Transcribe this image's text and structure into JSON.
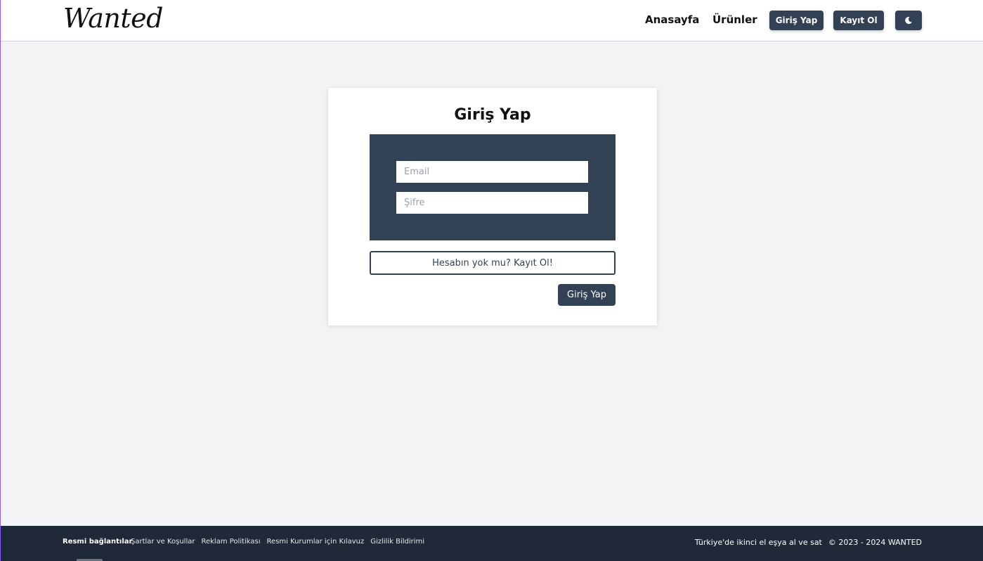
{
  "header": {
    "logo": "Wanted",
    "nav": [
      {
        "label": "Anasayfa"
      },
      {
        "label": "Ürünler"
      }
    ],
    "login_button": "Giriş Yap",
    "register_button": "Kayıt Ol",
    "theme_toggle_icon": "moon-icon"
  },
  "login_card": {
    "title": "Giriş Yap",
    "email": {
      "value": "",
      "placeholder": "Email"
    },
    "password": {
      "value": "",
      "placeholder": "Şifre"
    },
    "signup_link": "Hesabın yok mu? Kayıt Ol!",
    "submit_label": "Giriş Yap"
  },
  "footer": {
    "links_title": "Resmi bağlantılar",
    "links": [
      "Şartlar ve Koşullar",
      "Reklam Politikası",
      "Resmi Kurumlar için Kılavuz",
      "Gizlilik Bildirimi"
    ],
    "tagline": "Türkiye'de ikinci el eşya al ve sat",
    "copyright": "© 2023 - 2024 WANTED"
  },
  "colors": {
    "primary": "#334155",
    "footer_bg": "#1f2937",
    "page_bg": "#f2f3f5"
  }
}
